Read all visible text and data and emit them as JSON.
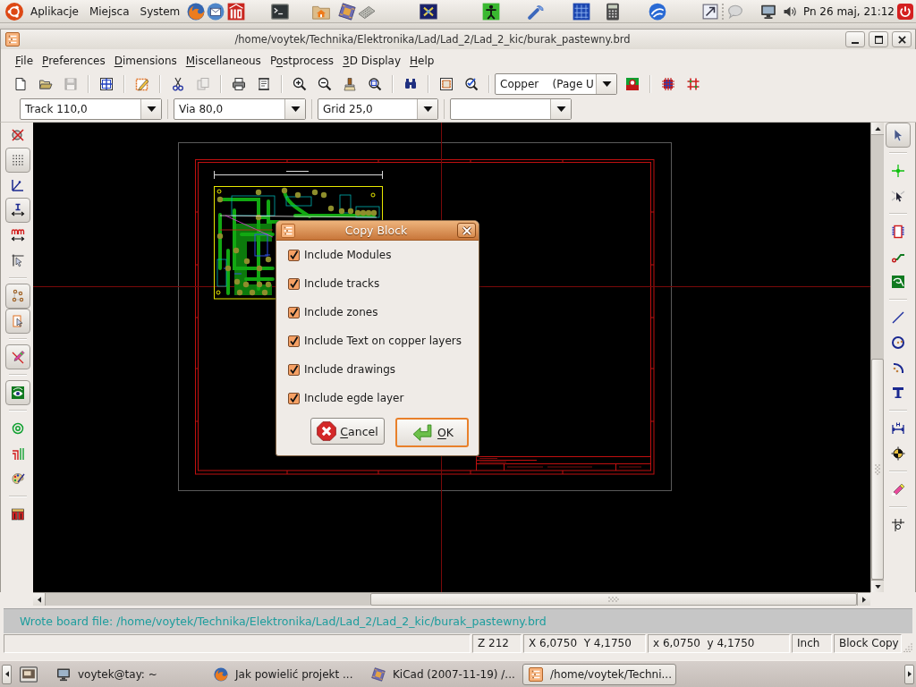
{
  "top_panel": {
    "menus": [
      "Aplikacje",
      "Miejsca",
      "System"
    ],
    "clock": "Pn 26 maj, 21:12"
  },
  "window": {
    "title": "/home/voytek/Technika/Elektronika/Lad/Lad_2/Lad_2_kic/burak_pastewny.brd"
  },
  "menu_bar": [
    {
      "key": "F",
      "rest": "ile"
    },
    {
      "key": "P",
      "rest": "references"
    },
    {
      "key": "D",
      "rest": "imensions"
    },
    {
      "key": "M",
      "rest": "iscellaneous"
    },
    {
      "lead": "P",
      "key": "o",
      "rest": "stprocess"
    },
    {
      "key": "3",
      "rest": "D Display"
    },
    {
      "key": "H",
      "rest": "elp"
    }
  ],
  "main_toolbar": {
    "groups": [
      [
        {
          "disabled": false
        },
        {
          "disabled": false
        },
        {
          "disabled": true
        }
      ],
      [
        {
          "disabled": false
        }
      ],
      [
        {
          "disabled": false
        }
      ],
      [
        {
          "disabled": false
        },
        {
          "disabled": true
        }
      ],
      [
        {
          "disabled": false
        },
        {
          "disabled": false
        }
      ],
      [
        {
          "disabled": false
        },
        {
          "disabled": false
        },
        {
          "disabled": false
        },
        {
          "disabled": false
        }
      ],
      [
        {
          "disabled": false
        }
      ],
      [
        {
          "disabled": false
        },
        {
          "disabled": false
        }
      ]
    ],
    "layer_select": "Copper    (Page U",
    "extra_groups": [
      [
        {
          "disabled": false
        }
      ],
      [
        {
          "disabled": false
        },
        {
          "disabled": false
        }
      ]
    ]
  },
  "options_bar": {
    "selects": [
      "Track 110,0",
      "Via 80,0",
      "Grid 25,0"
    ]
  },
  "left_toolbar": [
    [
      {
        "on": false
      },
      {
        "on": true
      },
      {
        "on": false
      },
      {
        "on": true
      },
      {
        "on": false
      },
      {
        "on": false
      }
    ],
    [
      {
        "on": true
      },
      {
        "on": true
      }
    ],
    [
      {
        "on": true
      }
    ],
    [
      {
        "on": true
      }
    ],
    [
      {
        "on": false
      },
      {
        "on": false
      },
      {
        "on": false
      }
    ],
    [
      {
        "on": false
      }
    ]
  ],
  "right_toolbar": [
    [
      {
        "on": true
      }
    ],
    [
      {
        "on": false
      },
      {
        "on": false
      }
    ],
    [
      {
        "on": false
      },
      {
        "on": false
      },
      {
        "on": false
      }
    ],
    [
      {
        "on": false
      },
      {
        "on": false
      },
      {
        "on": false
      },
      {
        "on": false
      }
    ],
    [
      {
        "on": false
      },
      {
        "on": false
      }
    ],
    [
      {
        "on": false
      }
    ],
    [
      {
        "on": false
      }
    ]
  ],
  "dialog": {
    "title": "Copy Block",
    "options": [
      {
        "label": "Include Modules",
        "checked": true
      },
      {
        "label": "Include tracks",
        "checked": true
      },
      {
        "label": "Include zones",
        "checked": true
      },
      {
        "label": "Include Text on copper layers",
        "checked": true
      },
      {
        "label": "Include drawings",
        "checked": true
      },
      {
        "label": "Include egde layer",
        "checked": true
      }
    ],
    "buttons": [
      {
        "kind": "cancel",
        "key": "C",
        "rest": "ancel",
        "focused": false
      },
      {
        "kind": "ok",
        "key": "O",
        "rest": "K",
        "focused": true
      }
    ]
  },
  "message_panel": {
    "text": "Wrote board file: /home/voytek/Technika/Elektronika/Lad/Lad_2/Lad_2_kic/burak_pastewny.brd"
  },
  "status_bar": [
    "Z 212",
    "X 6,0750  Y 4,1750",
    "x 6,0750  y 4,1750",
    "Inch",
    "Block Copy"
  ],
  "taskbar": {
    "tasks": [
      {
        "label": "voytek@tay: ~",
        "selected": false
      },
      {
        "label": "Jak powielić projekt ...",
        "selected": false
      },
      {
        "label": "KiCad (2007-11-19) /...",
        "selected": false
      },
      {
        "label": "/home/voytek/Techni...",
        "selected": true
      }
    ]
  }
}
